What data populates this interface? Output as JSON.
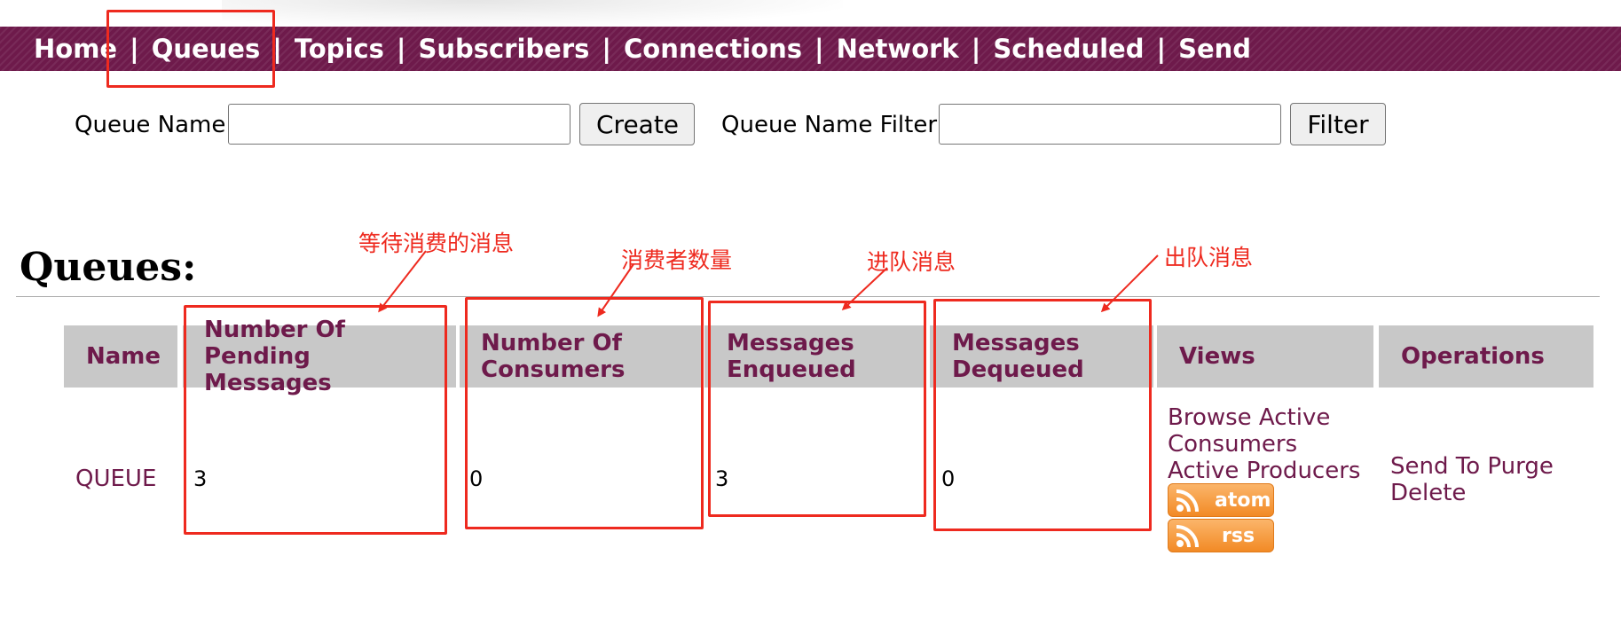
{
  "nav": {
    "items": [
      "Home",
      "Queues",
      "Topics",
      "Subscribers",
      "Connections",
      "Network",
      "Scheduled",
      "Send"
    ],
    "separator": "|"
  },
  "create_form": {
    "label": "Queue Name",
    "value": "",
    "button": "Create"
  },
  "filter_form": {
    "label": "Queue Name Filter",
    "value": "",
    "button": "Filter"
  },
  "section_title": "Queues:",
  "table": {
    "headers": {
      "name": "Name",
      "pending": [
        "Number Of Pending",
        "Messages"
      ],
      "consumers": [
        "Number Of",
        "Consumers"
      ],
      "enqueued": [
        "Messages",
        "Enqueued"
      ],
      "dequeued": [
        "Messages",
        "Dequeued"
      ],
      "views": "Views",
      "operations": "Operations"
    },
    "rows": [
      {
        "name": "QUEUE",
        "pending": "3",
        "consumers": "0",
        "enqueued": "3",
        "dequeued": "0",
        "views": [
          "Browse Active",
          "Consumers",
          "Active Producers"
        ],
        "feeds": [
          "atom",
          "rss"
        ],
        "operations": [
          "Send To Purge",
          "Delete"
        ]
      }
    ]
  },
  "annotations": {
    "pending": "等待消费的消息",
    "consumers": "消费者数量",
    "enqueued": "进队消息",
    "dequeued": "出队消息"
  },
  "colors": {
    "brand": "#6e1a4b",
    "header_bg": "#c8c8c8",
    "annotation": "#ee2a1f",
    "feed": "#f28a25"
  },
  "icons": [
    "rss-feed-icon"
  ]
}
